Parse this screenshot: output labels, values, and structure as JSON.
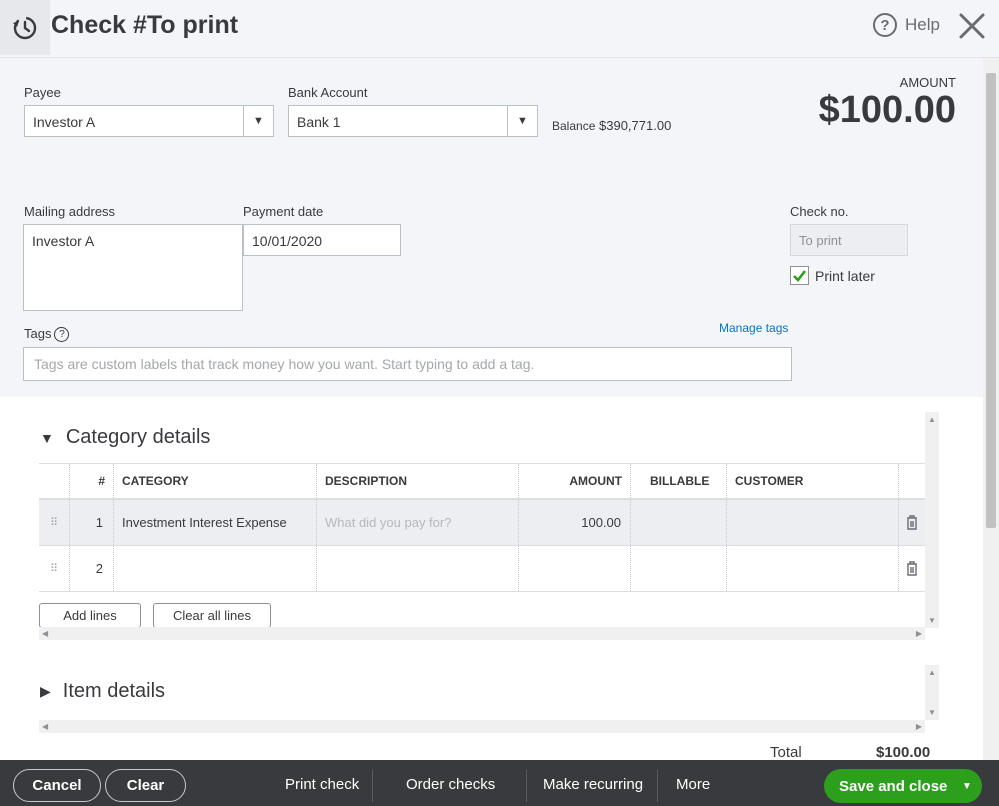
{
  "header": {
    "title": "Check #To print",
    "help_label": "Help"
  },
  "form": {
    "payee_label": "Payee",
    "payee_value": "Investor A",
    "bank_label": "Bank Account",
    "bank_value": "Bank 1",
    "balance_label": "Balance",
    "balance_value": "$390,771.00",
    "amount_label": "AMOUNT",
    "amount_value": "$100.00",
    "mailing_label": "Mailing address",
    "mailing_value": "Investor A",
    "payment_date_label": "Payment date",
    "payment_date_value": "10/01/2020",
    "check_no_label": "Check no.",
    "check_no_placeholder": "To print",
    "print_later_label": "Print later",
    "print_later_checked": true,
    "tags_label": "Tags",
    "manage_tags": "Manage tags",
    "tags_placeholder": "Tags are custom labels that track money how you want. Start typing to add a tag."
  },
  "category": {
    "title": "Category details",
    "headers": [
      "#",
      "CATEGORY",
      "DESCRIPTION",
      "AMOUNT",
      "BILLABLE",
      "CUSTOMER"
    ],
    "rows": [
      {
        "num": "1",
        "category": "Investment Interest Expense",
        "description_placeholder": "What did you pay for?",
        "amount": "100.00"
      },
      {
        "num": "2",
        "category": "",
        "description_placeholder": "",
        "amount": ""
      }
    ],
    "add_lines": "Add lines",
    "clear_all_lines": "Clear all lines"
  },
  "items": {
    "title": "Item details"
  },
  "totals": {
    "label": "Total",
    "value": "$100.00"
  },
  "footer": {
    "cancel": "Cancel",
    "clear": "Clear",
    "print_check": "Print check",
    "order_checks": "Order checks",
    "make_recurring": "Make recurring",
    "more": "More",
    "save_and_close": "Save and close"
  },
  "colors": {
    "accent_green": "#2ca01c",
    "link_blue": "#0077c5",
    "footer_bg": "#393a3d"
  }
}
